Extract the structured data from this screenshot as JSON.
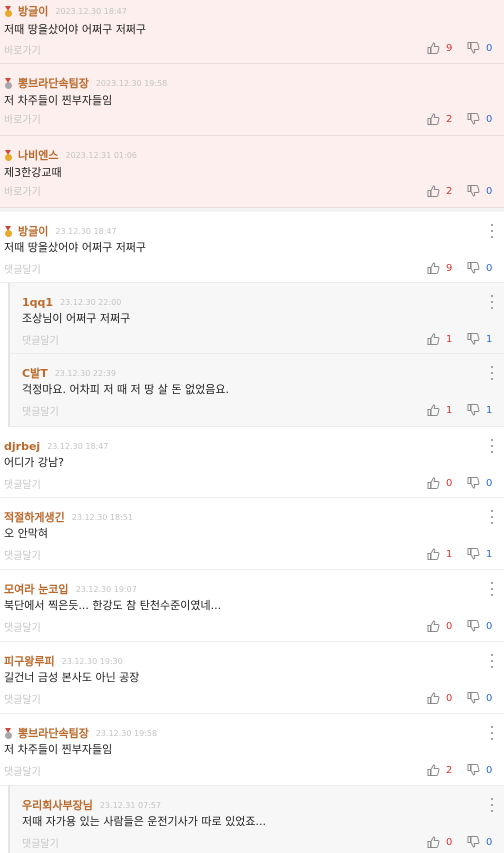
{
  "best_comments": [
    {
      "nick": "방글이",
      "date": "2023.12.30 18:47",
      "text": "저때 땅을샀어야 어쩌구 저쩌구",
      "link": "바로가기",
      "up": "9",
      "down": "0",
      "medal": "gold-medal-icon"
    },
    {
      "nick": "뽕브라단속팀장",
      "date": "2023.12.30 19:58",
      "text": "저 차주들이 찐부자들임",
      "link": "바로가기",
      "up": "2",
      "down": "0",
      "medal": "silver-medal-icon"
    },
    {
      "nick": "나비엔스",
      "date": "2023.12.31 01:06",
      "text": "제3한강교때",
      "link": "바로가기",
      "up": "2",
      "down": "0",
      "medal": "gold-medal-icon"
    }
  ],
  "comments": [
    {
      "nick": "방글이",
      "date": "23.12.30 18:47",
      "text": "저때 땅을샀어야 어쩌구 저쩌구",
      "reply": "댓글달기",
      "up": "9",
      "down": "0",
      "medal": "gold",
      "is_reply": false
    },
    {
      "nick": "1qq1",
      "date": "23.12.30 22:00",
      "text": "조상님이 어쩌구 저쩌구",
      "reply": "댓글달기",
      "up": "1",
      "down": "1",
      "medal": "",
      "is_reply": true
    },
    {
      "nick": "C발T",
      "date": "23.12.30 22:39",
      "text": "걱정마요. 어차피 저 때 저 땅 살 돈 없었음요.",
      "reply": "댓글달기",
      "up": "1",
      "down": "1",
      "medal": "",
      "is_reply": true
    },
    {
      "nick": "djrbej",
      "date": "23.12.30 18:47",
      "text": "어디가 강남?",
      "reply": "댓글달기",
      "up": "0",
      "down": "0",
      "medal": "",
      "is_reply": false
    },
    {
      "nick": "적절하게생긴",
      "date": "23.12.30 18:51",
      "text": "오 안막혀",
      "reply": "댓글달기",
      "up": "1",
      "down": "1",
      "medal": "",
      "is_reply": false
    },
    {
      "nick": "모여라 눈코입",
      "date": "23.12.30 19:07",
      "text": "북단에서 찍은듯... 한강도 참 탄천수준이였네...",
      "reply": "댓글달기",
      "up": "0",
      "down": "0",
      "medal": "",
      "is_reply": false
    },
    {
      "nick": "피구왕루피",
      "date": "23.12.30 19:30",
      "text": "길건너 금성 본사도 아닌 공장",
      "reply": "댓글달기",
      "up": "0",
      "down": "0",
      "medal": "",
      "is_reply": false
    },
    {
      "nick": "뽕브라단속팀장",
      "date": "23.12.30 19:58",
      "text": "저 차주들이 찐부자들임",
      "reply": "댓글달기",
      "up": "2",
      "down": "0",
      "medal": "silver",
      "is_reply": false
    },
    {
      "nick": "우리회사부장님",
      "date": "23.12.31 07:57",
      "text": "저때 자가용 있는 사람들은 운전기사가 따로 있었죠...",
      "reply": "댓글달기",
      "up": "0",
      "down": "0",
      "medal": "",
      "is_reply": true
    }
  ],
  "icons": {
    "like": "thumbs-up-icon",
    "dislike": "thumbs-down-icon",
    "more": "more-vertical-icon"
  },
  "colors": {
    "nick": "#bb6a2c",
    "up": "#d8342c",
    "down": "#2b6ad8",
    "best_bg": "#fcefee"
  }
}
